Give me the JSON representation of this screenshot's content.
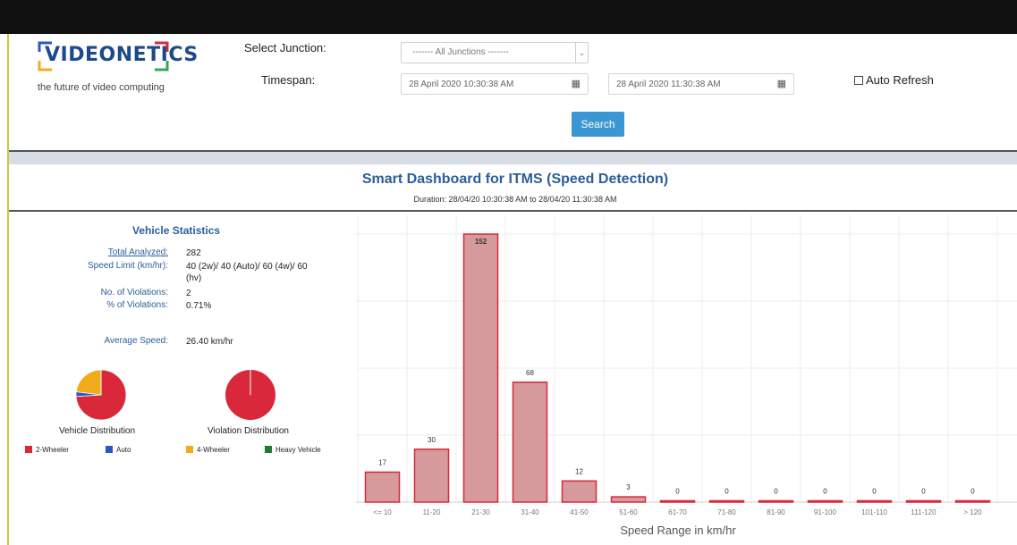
{
  "header": {
    "logo_text": "VIDEONETICS",
    "tagline": "the future of video computing",
    "select_junction_label": "Select Junction:",
    "junction_value": "------- All Junctions -------",
    "timespan_label": "Timespan:",
    "start_datetime": "28 April 2020 10:30:38 AM",
    "end_datetime": "28 April 2020 11:30:38 AM",
    "auto_refresh_label": "Auto Refresh",
    "auto_refresh_checked": false,
    "search_button": "Search"
  },
  "dashboard": {
    "title": "Smart Dashboard for ITMS (Speed Detection)",
    "duration": "Duration: 28/04/20 10:30:38 AM  to  28/04/20 11:30:38 AM"
  },
  "vehicle_statistics": {
    "title": "Vehicle Statistics",
    "total_analyzed_label": "Total Analyzed:",
    "total_analyzed_value": "282",
    "speed_limit_label": "Speed Limit (km/hr):",
    "speed_limit_value": "40 (2w)/ 40 (Auto)/ 60 (4w)/ 60 (hv)",
    "violations_label": "No. of Violations:",
    "violations_value": "2",
    "pct_violations_label": "% of Violations:",
    "pct_violations_value": "0.71%",
    "avg_speed_label": "Average Speed:",
    "avg_speed_value": "26.40 km/hr",
    "vehicle_distribution_label": "Vehicle Distribution",
    "violation_distribution_label": "Violation Distribution",
    "legend": [
      {
        "label": "2-Wheeler",
        "color": "#d9283a"
      },
      {
        "label": "Auto",
        "color": "#2b57c4"
      },
      {
        "label": "4-Wheeler",
        "color": "#f2ab1b"
      },
      {
        "label": "Heavy Vehicle",
        "color": "#1f7a3a"
      }
    ],
    "vehicle_distribution_shares": [
      {
        "label": "2-Wheeler",
        "value": 0.74
      },
      {
        "label": "Auto",
        "value": 0.03
      },
      {
        "label": "4-Wheeler",
        "value": 0.23
      },
      {
        "label": "Heavy Vehicle",
        "value": 0.0
      }
    ],
    "violation_distribution_shares": [
      {
        "label": "2-Wheeler",
        "value": 1.0
      },
      {
        "label": "Auto",
        "value": 0.0
      },
      {
        "label": "4-Wheeler",
        "value": 0.0
      },
      {
        "label": "Heavy Vehicle",
        "value": 0.0
      }
    ]
  },
  "chart_data": {
    "type": "bar",
    "categories": [
      "<= 10",
      "11-20",
      "21-30",
      "31-40",
      "41-50",
      "51-60",
      "61-70",
      "71-80",
      "81-90",
      "91-100",
      "101-110",
      "111-120",
      "> 120"
    ],
    "values": [
      17,
      30,
      152,
      68,
      12,
      3,
      0,
      0,
      0,
      0,
      0,
      0,
      0
    ],
    "xlabel": "Speed Range in km/hr",
    "ylim": [
      0,
      152
    ],
    "grid": true,
    "bar_color": "#d69a9c",
    "bar_edge_color": "#d9283a"
  }
}
